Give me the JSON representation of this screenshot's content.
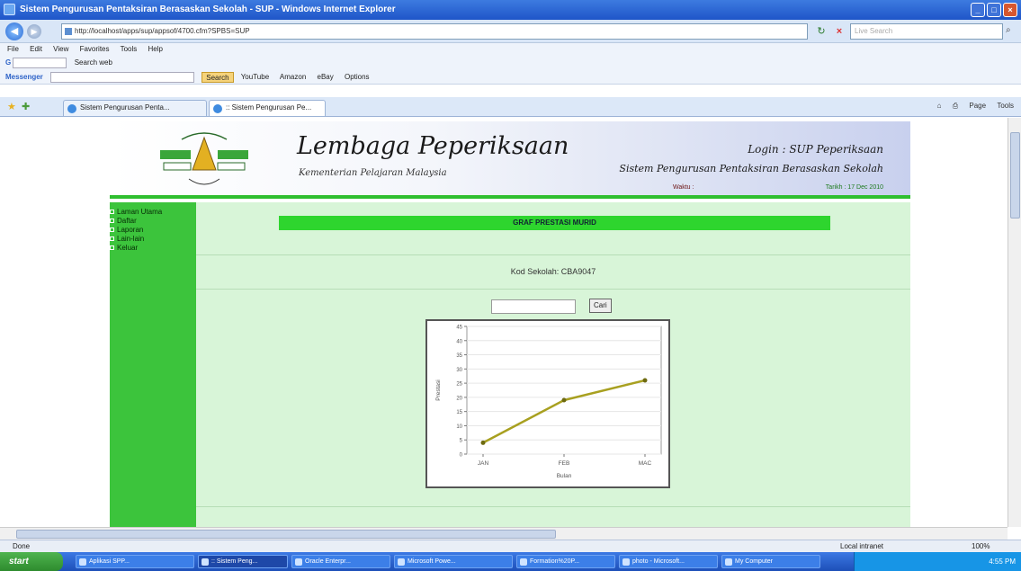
{
  "window": {
    "title": "Sistem Pengurusan Pentaksiran Berasaskan Sekolah - SUP - Windows Internet Explorer"
  },
  "address": {
    "url": "http://localhost/apps/sup/appsof/4700.cfm?SPBS=SUP",
    "search_placeholder": "Live Search"
  },
  "menu": [
    "File",
    "Edit",
    "View",
    "Favorites",
    "Tools",
    "Help"
  ],
  "google_bar": {
    "label": "Search web"
  },
  "msn_bar": {
    "brand": "Messenger",
    "search_label": "Search",
    "links": [
      "YouTube",
      "Amazon",
      "eBay",
      "Options"
    ]
  },
  "tabs": [
    {
      "label": "Sistem Pengurusan Penta..."
    },
    {
      "label": ":: Sistem Pengurusan Pe..."
    }
  ],
  "cmdbar": [
    "Page",
    "Tools"
  ],
  "banner": {
    "title": "Lembaga Peperiksaan",
    "subtitle": "Kementerian Pelajaran Malaysia",
    "login": "Login : SUP Peperiksaan",
    "system": "Sistem Pengurusan Pentaksiran Berasaskan Sekolah",
    "waktu": "Waktu :",
    "tarikh": "Tarikh : 17 Dec 2010"
  },
  "sidebar": {
    "items": [
      "Laman Utama",
      "Daftar",
      "Laporan",
      "Lain-lain",
      "Keluar"
    ]
  },
  "content": {
    "heading": "GRAF PRESTASI MURID",
    "kod_label": "Kod Sekolah: CBA9047",
    "input_value": "",
    "button_label": "Cari"
  },
  "chart_data": {
    "type": "line",
    "categories": [
      "JAN",
      "FEB",
      "MAC"
    ],
    "series": [
      {
        "values": [
          4,
          19,
          26
        ]
      }
    ],
    "xlabel": "Bulan",
    "ylabel": "Prestasi",
    "ylim": [
      0,
      45
    ],
    "yticks": [
      0,
      5,
      10,
      15,
      20,
      25,
      30,
      35,
      40,
      45
    ],
    "grid": true,
    "line_color": "#a8a020",
    "marker_color": "#6e6a10"
  },
  "status": {
    "left": "Done",
    "zone": "Local intranet",
    "zoom": "100%"
  },
  "taskbar": {
    "start": "start",
    "items": [
      "Aplikasi SPP...",
      ":: Sistem Peng...",
      "Oracle Enterpr...",
      "Microsoft Powe...",
      "Formation%20P...",
      "photo - Microsoft...",
      "My Computer"
    ],
    "clock": "4:55 PM"
  },
  "colors": {
    "sidebar_green": "#3cc43c",
    "content_bg": "#d8f5d8",
    "heading_green": "#2ed52e"
  }
}
